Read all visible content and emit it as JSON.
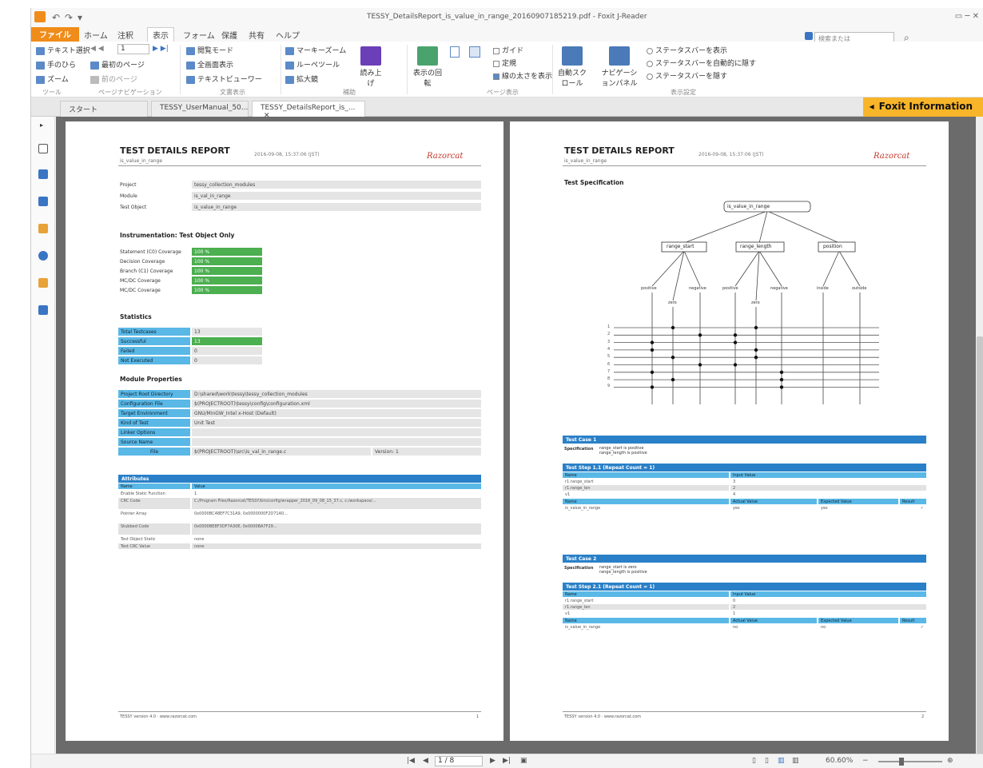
{
  "titlebar": {
    "title": "TESSY_DetailsReport_is_value_in_range_20160907185219.pdf - Foxit J-Reader",
    "quick_access": [
      "↶",
      "↷",
      "▾"
    ]
  },
  "ribbon_tabs": [
    "ファイル",
    "ホーム",
    "注釈",
    "表示",
    "フォーム",
    "保護",
    "共有",
    "ヘルプ"
  ],
  "ribbon": {
    "select_text": "テキスト選択",
    "hand": "手のひら",
    "zoom": "ズーム",
    "page_input": "1",
    "first_page": "最初のページ",
    "prev_page": "前のページ",
    "group_tool": "ツール",
    "group_nav": "ページナビゲーション",
    "reading_mode": "閲覧モード",
    "full_screen": "全画面表示",
    "text_viewer": "テキストビューワー",
    "group_view": "文書表示",
    "marquee": "マーキーズーム",
    "loupe": "ルーペツール",
    "magnifier": "拡大鏡",
    "group_assist": "補助",
    "read_aloud": "読み上げ",
    "rotate": "表示の回転",
    "group_page_display": "ページ表示",
    "guides": "ガイド",
    "rulers": "定規",
    "line_weights": "線の太さを表示",
    "auto_scroll": "自動スクロール",
    "nav_panel": "ナビゲーションパネル",
    "status_show": "ステータスバーを表示",
    "status_autohide": "ステータスバーを自動的に隠す",
    "status_hide": "ステータスバーを隠す",
    "group_display": "表示設定",
    "search_placeholder": "検索または"
  },
  "doc_tabs": [
    "スタート",
    "TESSY_UserManual_50...",
    "TESSY_DetailsReport_is_..."
  ],
  "foxit_info": "Foxit Information",
  "page1": {
    "title": "TEST DETAILS REPORT",
    "subtitle": "is_value_in_range",
    "date": "2016-09-08, 15:37:06 (JST)",
    "logo": "Razorcat",
    "info_labels": [
      "Project",
      "Module",
      "Test Object"
    ],
    "info_values": [
      "tessy_collection_modules",
      "is_val_in_range",
      "is_value_in_range"
    ],
    "section_instrumentation": "Instrumentation: Test Object Only",
    "coverage_labels": [
      "Statement (C0) Coverage",
      "Decision Coverage",
      "Branch (C1) Coverage",
      "MC/DC Coverage",
      "MC/DC Coverage"
    ],
    "coverage_values": [
      "100 %",
      "100 %",
      "100 %",
      "100 %",
      "100 %"
    ],
    "section_statistics": "Statistics",
    "stat_labels": [
      "Total Testcases",
      "Successful",
      "Failed",
      "Not Executed"
    ],
    "stat_values": [
      "13",
      "13",
      "0",
      "0"
    ],
    "section_module": "Module Properties",
    "module_labels": [
      "Project Root Directory",
      "Configuration File",
      "Target Environment",
      "Kind of Test",
      "Linker Options",
      "Source Name",
      "File"
    ],
    "module_values": [
      "D:\\shared\\work\\tessy\\tessy_collection_modules",
      "$(PROJECTROOT)\\tessy\\config\\configuration.xml",
      "GNU/MinGW_Intel x-Host (Default)",
      "Unit Test",
      "",
      "",
      "$(PROJECTROOT)\\src\\is_val_in_range.c"
    ],
    "version_label": "Version: 1",
    "attributes_title": "Attributes",
    "attr_headers": [
      "Name",
      "Value"
    ],
    "attr_names": [
      "Enable Static Function",
      "CRC Code",
      "Pointer Array",
      "Stubbed Code",
      "Test Object Static",
      "Test CRC Value"
    ],
    "attr_values": [
      "1",
      "C:/Program Files/Razorcat/TESSY/bin/config/wrapper_2016_09_08_15_37.c, c:/workspace/...",
      "0x0000BC48EF7C31A9, 0x0000000F2D71A0...",
      "0x0000BE8F3DF7A30E, 0x0000BA7F29...",
      "none",
      "none"
    ],
    "footer_left": "TESSY version 4.0 · www.razorcat.com",
    "footer_right": "1"
  },
  "page2": {
    "title": "TEST DETAILS REPORT",
    "subtitle": "is_value_in_range",
    "date": "2016-09-08, 15:37:06 (JST)",
    "logo": "Razorcat",
    "section_spec": "Test Specification",
    "tree_root": "is_value_in_range",
    "tree_children": [
      "range_start",
      "range_length",
      "position"
    ],
    "tree_leaves": [
      "positive",
      "zero",
      "negative",
      "positive",
      "zero",
      "negative",
      "inside",
      "outside"
    ],
    "matrix_rows": [
      "1",
      "2",
      "3",
      "4",
      "5",
      "6",
      "7",
      "8",
      "9"
    ],
    "tc1_title": "Test Case 1",
    "tc1_spec_label": "Specification",
    "tc1_spec": [
      "range_start is positive",
      "range_length is positive"
    ],
    "ts1_title": "Test Step 1.1 (Repeat Count = 1)",
    "tc2_title": "Test Case 2",
    "tc2_spec_label": "Specification",
    "tc2_spec": [
      "range_start is zero",
      "range_length is positive"
    ],
    "ts2_title": "Test Step 2.1 (Repeat Count = 1)",
    "io_headers": [
      "Name",
      "Input Value"
    ],
    "in_names": [
      "r1.range_start",
      "r1.range_len",
      "v1"
    ],
    "in_values1": [
      "3",
      "2",
      "4"
    ],
    "in_values2": [
      "0",
      "2",
      "1"
    ],
    "out_headers": [
      "Name",
      "Actual Value",
      "Expected Value",
      "Result"
    ],
    "out1": [
      "is_value_in_range",
      "yes",
      "yes",
      "✓"
    ],
    "out2": [
      "is_value_in_range",
      "no",
      "no",
      "✓"
    ],
    "footer_left": "TESSY version 4.0 · www.razorcat.com",
    "footer_right": "2"
  },
  "status": {
    "page_text": "1 / 8",
    "zoom": "60.60%"
  },
  "colors": {
    "accent_orange": "#f08c1a",
    "foxit_yellow": "#f8b529",
    "table_blue": "#2a80c8",
    "label_blue": "#59b8e6",
    "pass_green": "#4caf50"
  }
}
